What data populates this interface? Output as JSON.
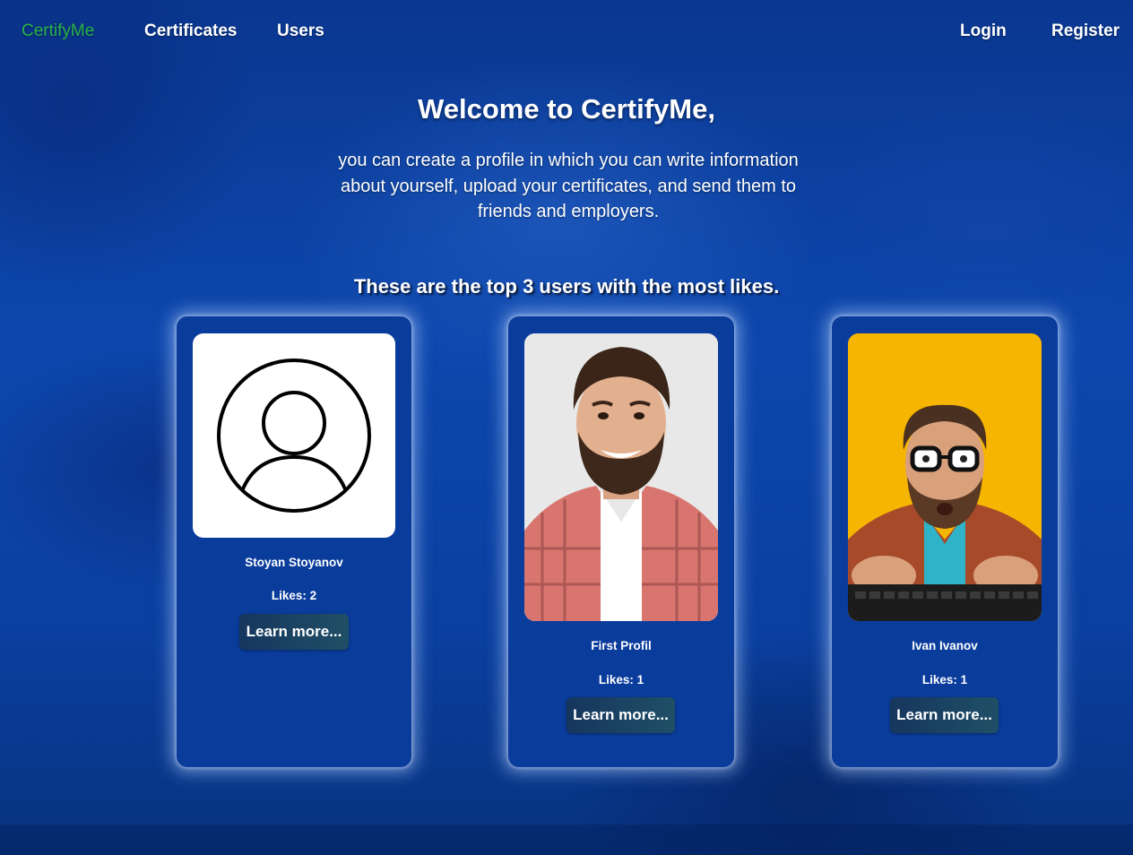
{
  "nav": {
    "brand": "CertifyMe",
    "links": [
      "Certificates",
      "Users"
    ],
    "login": "Login",
    "register": "Register"
  },
  "colors": {
    "brand": "#2ab34a",
    "background": "#0b3f9a",
    "card": "#0a3c9c",
    "button": "#1a4262"
  },
  "hero": {
    "title": "Welcome to CertifyMe,",
    "text": "you can create a profile in which you can write information about yourself, upload your certificates, and send them to friends and employers.",
    "top_heading": "These are the top 3 users with the most likes."
  },
  "users": [
    {
      "name": "Stoyan Stoyanov",
      "likes": "Likes: 2",
      "button": "Learn more...",
      "photo_icon": "default-avatar-icon"
    },
    {
      "name": "First Profil",
      "likes": "Likes: 1",
      "button": "Learn more...",
      "photo_icon": "user-photo"
    },
    {
      "name": "Ivan Ivanov",
      "likes": "Likes: 1",
      "button": "Learn more...",
      "photo_icon": "user-photo"
    }
  ]
}
